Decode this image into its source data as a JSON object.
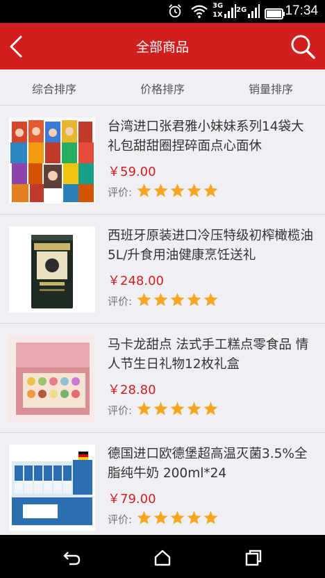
{
  "status": {
    "time": "17:34",
    "net1": "3G",
    "net2": "1X",
    "net3": "2G"
  },
  "header": {
    "title": "全部商品"
  },
  "sort_tabs": [
    "综合排序",
    "价格排序",
    "销量排序"
  ],
  "products": [
    {
      "name": "台湾进口张君雅小妹妹系列14袋大礼包甜甜圈捏碎面点心面休",
      "price": "￥59.00",
      "rating_label": "评价:",
      "stars": 5
    },
    {
      "name": "西班牙原装进口冷压特级初榨橄榄油5L/升食用油健康烹饪送礼",
      "price": "￥248.00",
      "rating_label": "评价:",
      "stars": 5
    },
    {
      "name": "马卡龙甜点 法式手工糕点零食品 情人节生日礼物12枚礼盒",
      "price": "￥28.80",
      "rating_label": "评价:",
      "stars": 5
    },
    {
      "name": "德国进口欧德堡超高温灭菌3.5%全脂纯牛奶 200ml*24",
      "price": "￥79.00",
      "rating_label": "评价:",
      "stars": 5
    }
  ],
  "colors": {
    "brand_red": "#d11f1f",
    "star": "#f5a623"
  },
  "icons": {
    "back": "back-arrow-icon",
    "search": "search-icon",
    "nav_back": "nav-back-icon",
    "nav_home": "nav-home-icon",
    "nav_recents": "nav-recents-icon"
  }
}
